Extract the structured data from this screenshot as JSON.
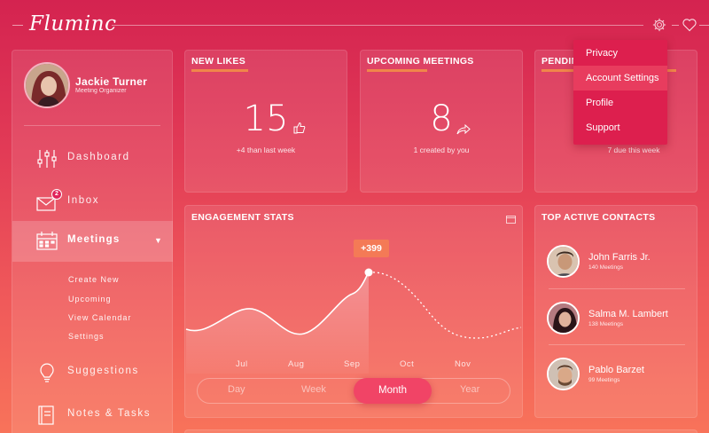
{
  "app": {
    "logo_text": "Fluminc"
  },
  "header": {
    "settings_icon": "gear-icon",
    "favorites_icon": "heart-icon"
  },
  "user": {
    "name": "Jackie Turner",
    "role": "Meeting Organizer"
  },
  "sidebar": {
    "items": [
      {
        "label": "Dashboard",
        "icon": "sliders-icon"
      },
      {
        "label": "Inbox",
        "icon": "envelope-icon",
        "badge": "2"
      },
      {
        "label": "Meetings",
        "icon": "calendar-icon",
        "active": true
      },
      {
        "label": "Suggestions",
        "icon": "lightbulb-icon"
      },
      {
        "label": "Notes & Tasks",
        "icon": "notes-icon"
      }
    ],
    "submenu": [
      "Create New",
      "Upcoming",
      "View Calendar",
      "Settings"
    ]
  },
  "cards": {
    "new_likes": {
      "title": "NEW LIKES",
      "value": "15",
      "subtext": "+4 than last week",
      "icon": "thumbs-up-icon"
    },
    "upcoming_meetings": {
      "title": "UPCOMING MEETINGS",
      "value": "8",
      "subtext": "1 created by you",
      "icon": "share-arrow-icon"
    },
    "pending": {
      "title": "PENDING",
      "subtext": "7 due this week"
    }
  },
  "dropdown": {
    "items": [
      "Privacy",
      "Account Settings",
      "Profile",
      "Support"
    ],
    "highlighted": "Account Settings"
  },
  "engagement": {
    "title": "ENGAGEMENT STATS",
    "tooltip": "+399",
    "range_options": [
      "Day",
      "Week",
      "Month",
      "Year"
    ],
    "range_selected": "Month"
  },
  "chart_data": {
    "type": "area",
    "categories": [
      "Jul",
      "Aug",
      "Sep",
      "Oct",
      "Nov"
    ],
    "highlight_category": "Sep",
    "highlight_label": "+399"
  },
  "contacts": {
    "title": "TOP ACTIVE CONTACTS",
    "items": [
      {
        "name": "John Farris Jr.",
        "meetings": "140 Meetings"
      },
      {
        "name": "Salma M. Lambert",
        "meetings": "138 Meetings"
      },
      {
        "name": "Pablo Barzet",
        "meetings": "99 Meetings"
      }
    ]
  },
  "colors": {
    "accent": "#f0864a",
    "dropdown_bg": "#dd1f4e",
    "active_pill": "#f14466",
    "badge": "#e0235a"
  }
}
